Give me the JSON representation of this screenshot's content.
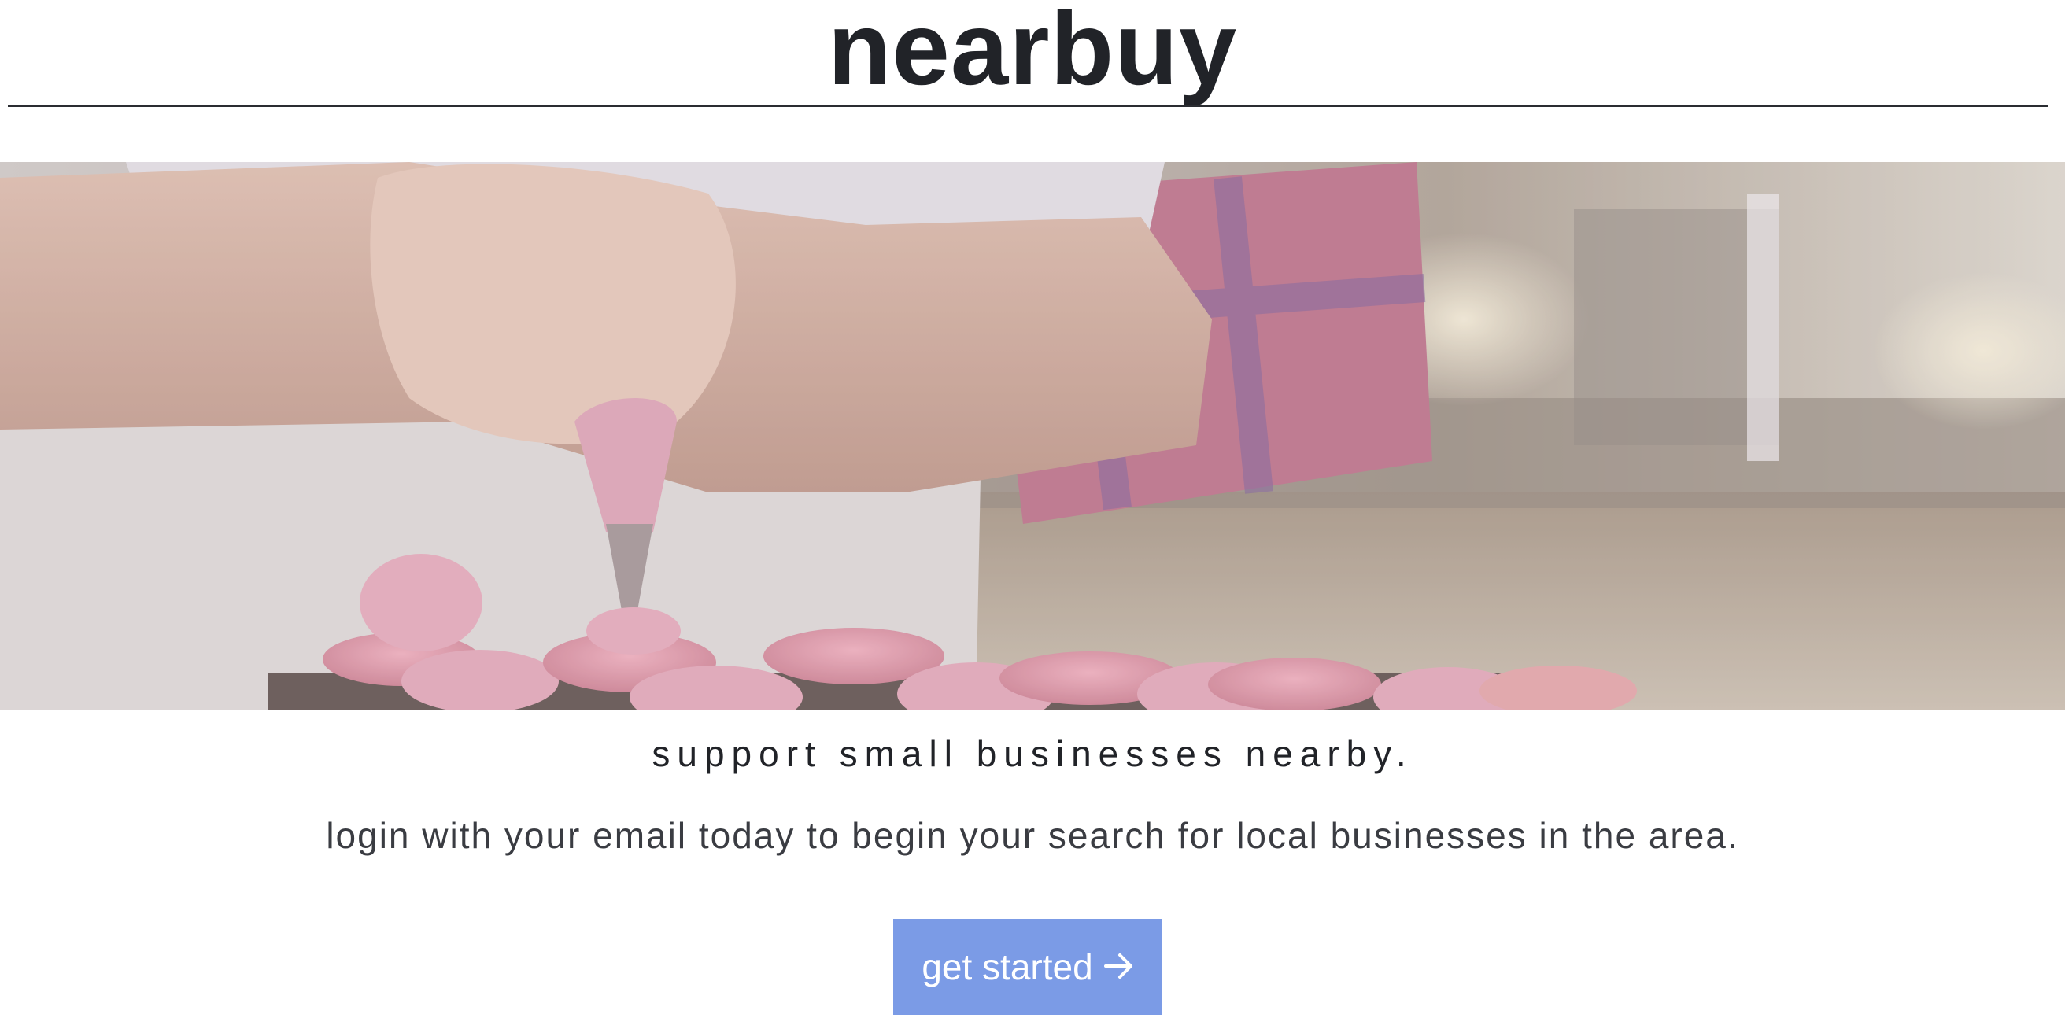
{
  "header": {
    "brand": "nearbuy"
  },
  "hero": {
    "image_alt": "hands piping pink meringue onto macarons"
  },
  "main": {
    "tagline": "support small businesses nearby.",
    "subtext": "login with your email today to begin your search for local businesses in the area.",
    "cta_label": "get started",
    "cta_icon": "arrow-right-icon"
  },
  "colors": {
    "text": "#212328",
    "cta_background": "#7b9be6",
    "cta_text": "#ffffff"
  }
}
